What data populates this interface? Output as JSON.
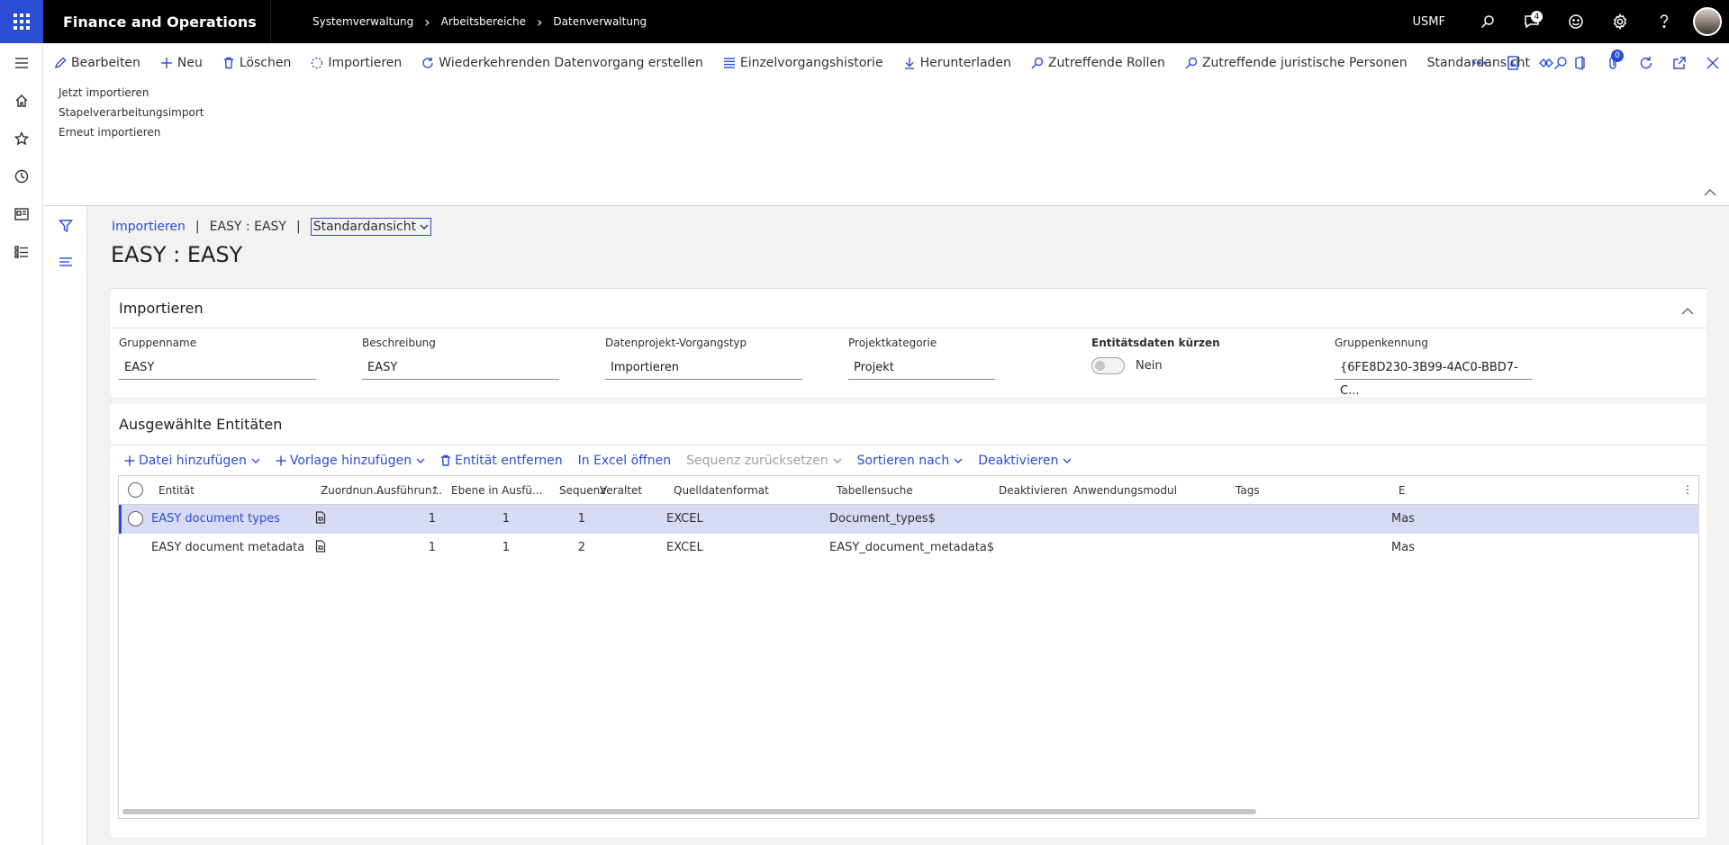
{
  "topbar": {
    "app_title": "Finance and Operations",
    "breadcrumb": [
      "Systemverwaltung",
      "Arbeitsbereiche",
      "Datenverwaltung"
    ],
    "company": "USMF",
    "notification_count": "4"
  },
  "actions": {
    "items": [
      "Bearbeiten",
      "Neu",
      "Löschen",
      "Importieren",
      "Wiederkehrenden Datenvorgang erstellen",
      "Einzelvorgangshistorie",
      "Herunterladen",
      "Zutreffende Rollen",
      "Zutreffende juristische Personen",
      "Standardansicht"
    ],
    "badge_count": "0",
    "sub_items": [
      "Jetzt importieren",
      "Stapelverarbeitungsimport",
      "Erneut importieren"
    ]
  },
  "page": {
    "crumb_link": "Importieren",
    "crumb_record": "EASY : EASY",
    "view": "Standardansicht",
    "title": "EASY : EASY"
  },
  "import_section": {
    "header": "Importieren",
    "fields": [
      {
        "label": "Gruppenname",
        "value": "EASY"
      },
      {
        "label": "Beschreibung",
        "value": "EASY"
      },
      {
        "label": "Datenprojekt-Vorgangstyp",
        "value": "Importieren"
      },
      {
        "label": "Projektkategorie",
        "value": "Projekt"
      },
      {
        "label": "Entitätsdaten kürzen",
        "value": "Nein"
      },
      {
        "label": "Gruppenkennung",
        "value": "{6FE8D230-3B99-4AC0-BBD7-C..."
      }
    ]
  },
  "entities_section": {
    "header": "Ausgewählte Entitäten",
    "toolbar": [
      "Datei hinzufügen",
      "Vorlage hinzufügen",
      "Entität entfernen",
      "In Excel öffnen",
      "Sequenz zurücksetzen",
      "Sortieren nach",
      "Deaktivieren"
    ],
    "columns": [
      "Entität",
      "Zuordnun...",
      "Ausführun...",
      "Ebene in Ausfü...",
      "Sequenz",
      "Veraltet",
      "Quelldatenformat",
      "Tabellensuche",
      "Deaktivieren",
      "Anwendungsmodul",
      "Tags",
      "E"
    ],
    "rows": [
      {
        "entity": "EASY document types",
        "exec": "1",
        "level": "1",
        "seq": "1",
        "format": "EXCEL",
        "table": "Document_types$",
        "module": "Mas"
      },
      {
        "entity": "EASY document metadata",
        "exec": "1",
        "level": "1",
        "seq": "2",
        "format": "EXCEL",
        "table": "EASY_document_metadata$",
        "module": "Mas"
      }
    ]
  },
  "colors": {
    "accent": "#2b4dd6",
    "topbar": "#000000",
    "selected_row": "#d8dbf5"
  }
}
